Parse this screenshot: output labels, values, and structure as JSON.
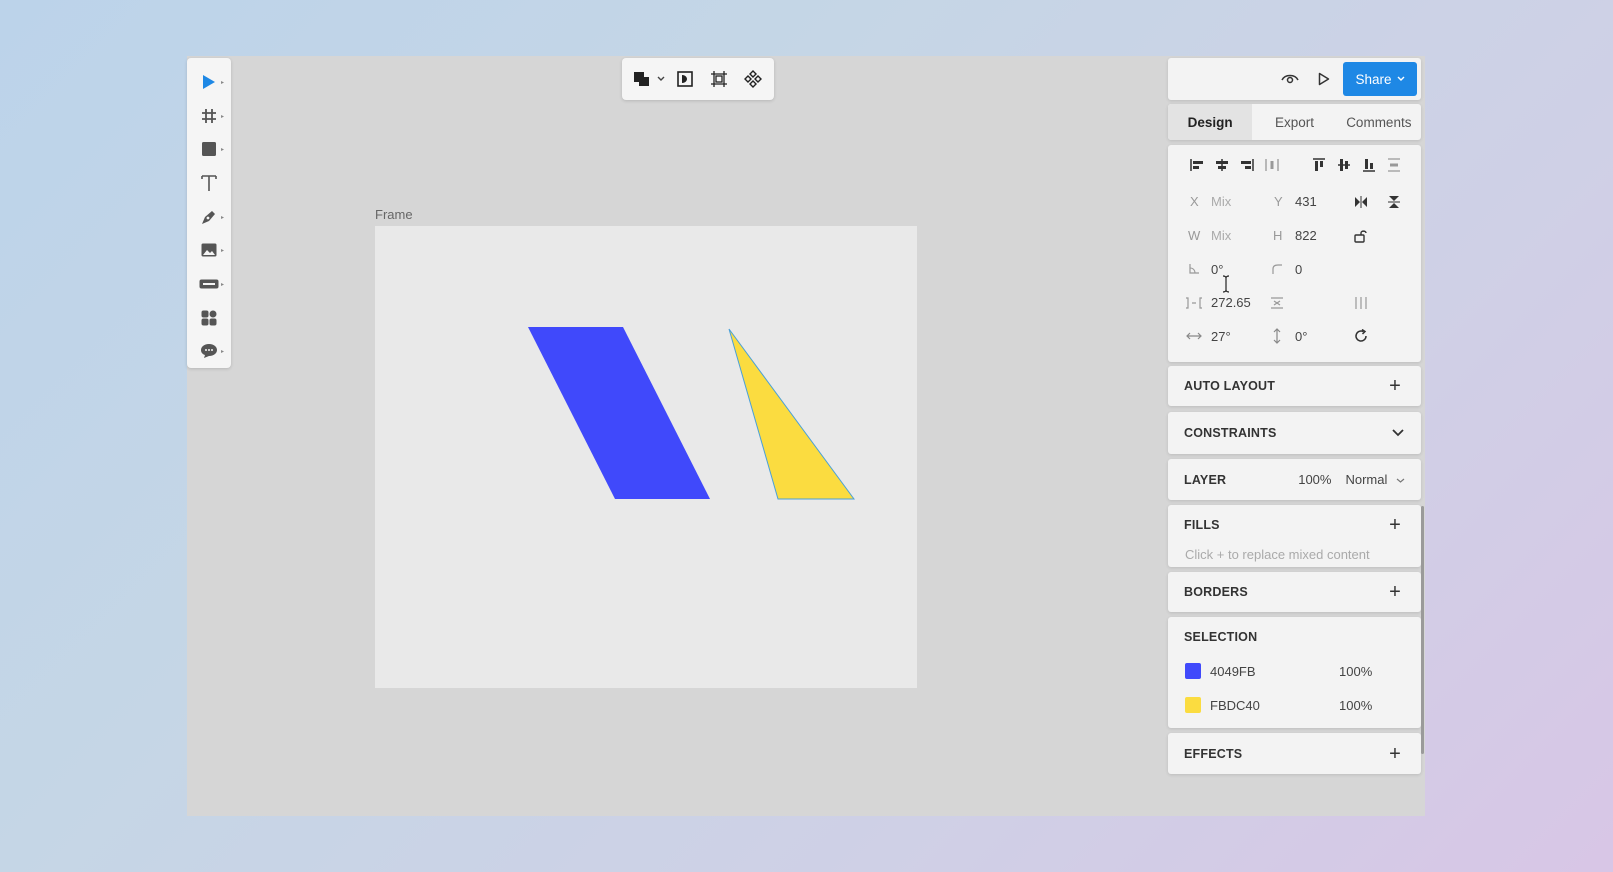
{
  "canvas": {
    "frame_label": "Frame",
    "shapes": [
      {
        "name": "blue-parallelogram",
        "fill": "#4049FB"
      },
      {
        "name": "yellow-triangle",
        "fill": "#FBDC40"
      }
    ]
  },
  "left_toolbar": {
    "tools": [
      "move-tool",
      "frame-tool",
      "rectangle-tool",
      "text-tool",
      "pen-tool",
      "image-tool",
      "widget-tool",
      "component-tool",
      "comment-tool"
    ]
  },
  "header": {
    "share_label": "Share"
  },
  "tabs": [
    {
      "label": "Design",
      "active": true
    },
    {
      "label": "Export",
      "active": false
    },
    {
      "label": "Comments",
      "active": false
    }
  ],
  "properties": {
    "x_label": "X",
    "x_value": "Mix",
    "y_label": "Y",
    "y_value": "431",
    "w_label": "W",
    "w_value": "Mix",
    "h_label": "H",
    "h_value": "822",
    "rotation": "0°",
    "corner_radius": "0",
    "spacing": "272.65",
    "skew_x": "27°",
    "skew_y": "0°"
  },
  "sections": {
    "auto_layout": "AUTO LAYOUT",
    "constraints": "CONSTRAINTS",
    "layer": {
      "title": "LAYER",
      "opacity": "100%",
      "blend": "Normal"
    },
    "fills": {
      "title": "FILLS",
      "hint": "Click + to replace mixed content"
    },
    "borders": "BORDERS",
    "selection": {
      "title": "SELECTION",
      "colors": [
        {
          "hex": "4049FB",
          "color": "#4049FB",
          "opacity": "100%"
        },
        {
          "hex": "FBDC40",
          "color": "#FBDC40",
          "opacity": "100%"
        }
      ]
    },
    "effects": "EFFECTS"
  },
  "colors": {
    "accent": "#1e88e5"
  }
}
